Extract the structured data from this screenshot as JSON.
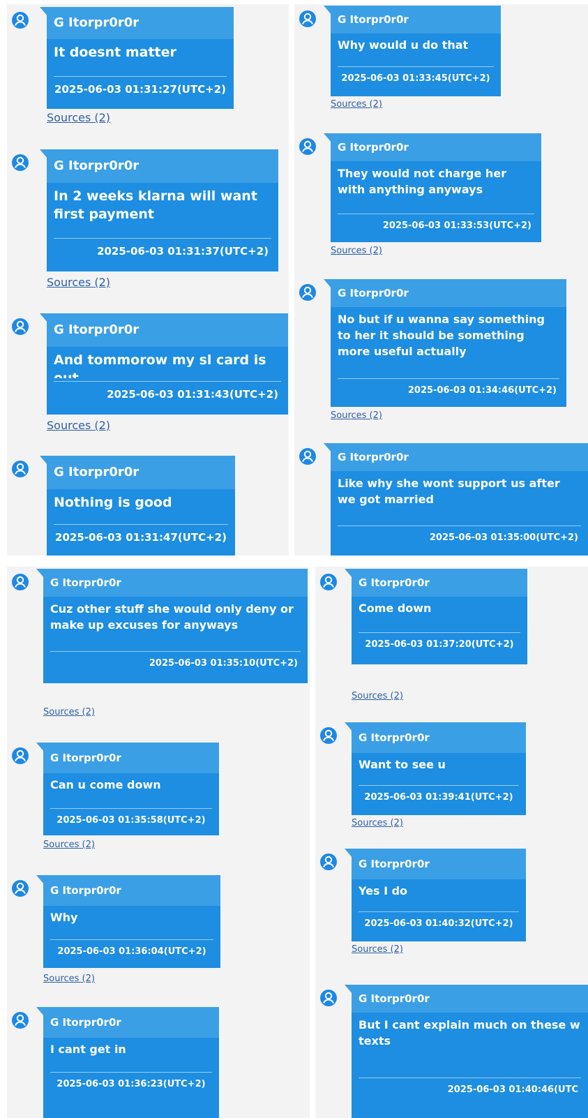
{
  "colors": {
    "panel_bg": "#f3f3f3",
    "bubble_body": "#1d8ee1",
    "bubble_header": "#3b9fe6",
    "text": "#ffffff",
    "link": "#2d5fa8",
    "avatar": "#1e88e5"
  },
  "icons": {
    "avatar": "user-icon"
  },
  "screenshots": [
    {
      "columns": [
        {
          "messages": [
            {
              "sender": "G Itorpr0r0r",
              "text": "It doesnt matter",
              "time": "2025-06-03 01:31:27(UTC+2)",
              "sources": "Sources (2)"
            },
            {
              "sender": "G Itorpr0r0r",
              "text": "In 2 weeks klarna will want first payment",
              "time": "2025-06-03 01:31:37(UTC+2)",
              "sources": "Sources (2)"
            },
            {
              "sender": "G Itorpr0r0r",
              "text": "And tommorow my sl card is out",
              "time": "2025-06-03 01:31:43(UTC+2)",
              "sources": "Sources (2)"
            },
            {
              "sender": "G Itorpr0r0r",
              "text": "Nothing is good",
              "time": "2025-06-03 01:31:47(UTC+2)"
            }
          ]
        },
        {
          "messages": [
            {
              "sender": "G Itorpr0r0r",
              "text": "Why would u do that",
              "time": "2025-06-03 01:33:45(UTC+2)",
              "sources": "Sources (2)"
            },
            {
              "sender": "G Itorpr0r0r",
              "text": "They would not charge her with anything anyways",
              "time": "2025-06-03 01:33:53(UTC+2)",
              "sources": "Sources (2)"
            },
            {
              "sender": "G Itorpr0r0r",
              "text": "No but if u wanna say something to her it should be something more useful actually",
              "time": "2025-06-03 01:34:46(UTC+2)",
              "sources": "Sources (2)"
            },
            {
              "sender": "G Itorpr0r0r",
              "text": "Like why she wont support us after we got married",
              "time": "2025-06-03 01:35:00(UTC+2)"
            }
          ]
        }
      ]
    },
    {
      "columns": [
        {
          "messages": [
            {
              "sender": "G Itorpr0r0r",
              "text": "Cuz other stuff she would only deny or make up excuses for anyways",
              "time": "2025-06-03 01:35:10(UTC+2)",
              "sources": "Sources (2)"
            },
            {
              "sender": "G Itorpr0r0r",
              "text": "Can u come down",
              "time": "2025-06-03 01:35:58(UTC+2)",
              "sources": "Sources (2)"
            },
            {
              "sender": "G Itorpr0r0r",
              "text": "Why",
              "time": "2025-06-03 01:36:04(UTC+2)",
              "sources": "Sources (2)"
            },
            {
              "sender": "G Itorpr0r0r",
              "text": "I cant get in",
              "time": "2025-06-03 01:36:23(UTC+2)"
            }
          ]
        },
        {
          "messages": [
            {
              "sender": "G Itorpr0r0r",
              "text": "Come down",
              "time": "2025-06-03 01:37:20(UTC+2)",
              "sources": "Sources (2)"
            },
            {
              "sender": "G Itorpr0r0r",
              "text": "Want to see u",
              "time": "2025-06-03 01:39:41(UTC+2)",
              "sources": "Sources (2)"
            },
            {
              "sender": "G Itorpr0r0r",
              "text": "Yes I do",
              "time": "2025-06-03 01:40:32(UTC+2)",
              "sources": "Sources (2)"
            },
            {
              "sender": "G Itorpr0r0r",
              "text": "But I cant explain much on these w texts",
              "time": "2025-06-03 01:40:46(UTC"
            }
          ]
        }
      ]
    }
  ]
}
